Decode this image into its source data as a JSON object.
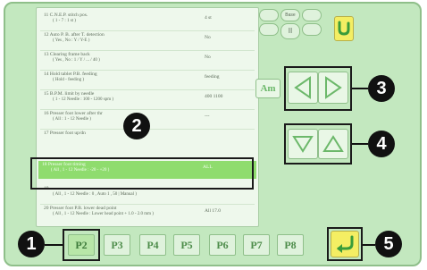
{
  "panel": {
    "caption": ""
  },
  "rows": [
    {
      "name": "11 C.N.E.P. stitch pos.",
      "range": "( 1 - 7 : 1 st )",
      "value": "4 st"
    },
    {
      "name": "12 Auto P. B. after T. detection",
      "range": "( Yes , No : Y / Y-E )",
      "value": "No"
    },
    {
      "name": "13 Clearing frame back",
      "range": "( Yes , No : 1 / Y / ... / 40 )",
      "value": "No"
    },
    {
      "name": "14 Hold tablet P.B. feeding",
      "range": "( Hold - feeding )",
      "value": "feeding"
    },
    {
      "name": "15 B.P.M. limit by needle",
      "range": "( 1 - 12 Needle : 100 - 1200 spm )",
      "value": "400 1100"
    },
    {
      "name": "16 Presser foot lower after thr",
      "range": "( All : 1 - 12 Needle )",
      "value": "---"
    },
    {
      "name": "17 Presser foot up/dn",
      "range": "",
      "value": ""
    },
    {
      "name": "18 Presser foot timing",
      "range": "( All , 1 - 12 Needle : -20 - +20 )",
      "value": "ALL"
    },
    {
      "name": "19",
      "range": "( All , 1 - 12 Needle : 0 , Auto 1 , 50 | Manual )",
      "value": ""
    },
    {
      "name": "20 Presser foot P.B. lower dead point",
      "range": "( All , 1 - 12 Needle : Lower head point + 1.0 - 2.0 mm )",
      "value": "All 17.0"
    }
  ],
  "callouts": {
    "one": "1",
    "two": "2",
    "three": "3",
    "four": "4",
    "five": "5"
  },
  "controls": {
    "oval_tl": "",
    "oval_top": "Base",
    "oval_tr": "",
    "oval_bl": "",
    "oval_mid": "II",
    "oval_br": "",
    "am_label": "Am"
  },
  "tabs": [
    "P2",
    "P3",
    "P4",
    "P5",
    "P6",
    "P7",
    "P8"
  ],
  "colors": {
    "screen_bg": "#c3e8bf",
    "highlight_row": "#8fdc6e",
    "yellow_button": "#f4ee63",
    "accent_green": "#6cb86a"
  },
  "icons": {
    "return_top": "u-turn-return-icon",
    "page_left": "left-triangle-icon",
    "page_right": "right-triangle-icon",
    "scroll_down": "down-triangle-icon",
    "scroll_up": "up-triangle-icon",
    "return_bottom": "enter-return-icon"
  }
}
